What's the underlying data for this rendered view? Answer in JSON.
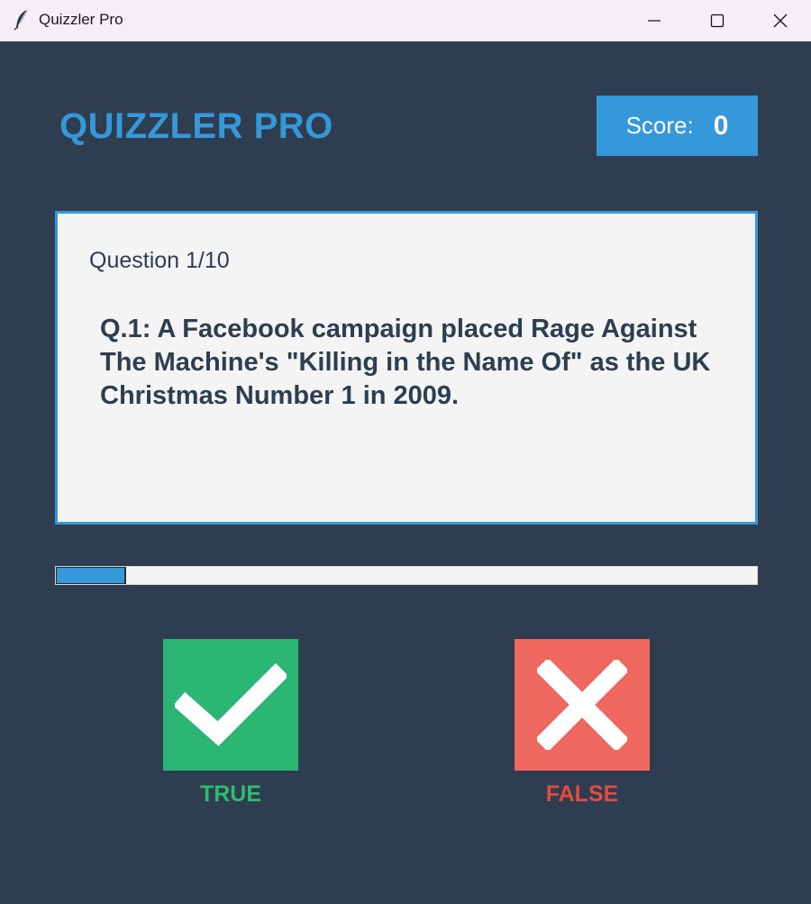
{
  "window": {
    "title": "Quizzler Pro"
  },
  "header": {
    "app_title": "QUIZZLER PRO",
    "score_label": "Score:",
    "score_value": "0"
  },
  "question": {
    "counter": "Question 1/10",
    "text": "Q.1: A Facebook campaign placed Rage Against The Machine's \"Killing in the Name Of\" as the UK Christmas Number 1 in 2009."
  },
  "progress": {
    "current": 1,
    "total": 10
  },
  "answers": {
    "true_label": "TRUE",
    "false_label": "FALSE"
  },
  "icons": {
    "app": "feather-icon",
    "true": "checkmark-icon",
    "false": "cross-icon"
  },
  "colors": {
    "background": "#2e3d4f",
    "accent": "#3498db",
    "true": "#2bb673",
    "false": "#ee685f",
    "card": "#f4f4f5"
  }
}
